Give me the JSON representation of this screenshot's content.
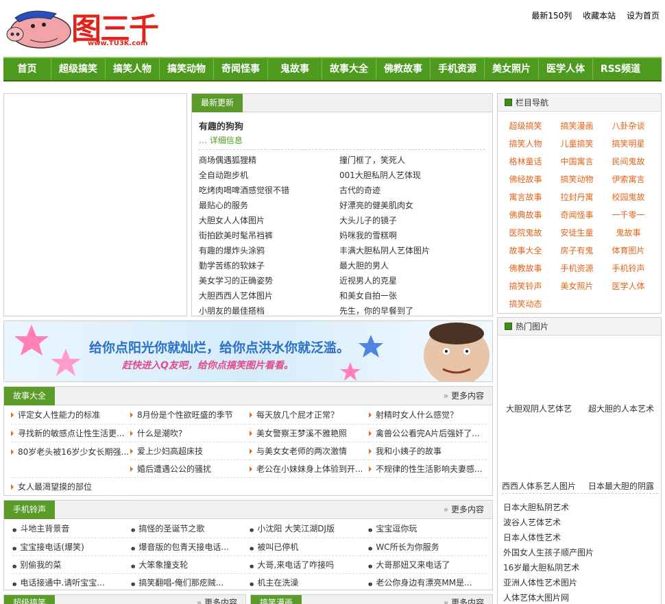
{
  "header": {
    "logo_text": "图三千",
    "logo_sub": "www.TU3K.com",
    "top_links": [
      "最新150列",
      "收藏本站",
      "设为首页"
    ]
  },
  "nav": [
    "首页",
    "超级搞笑",
    "搞笑人物",
    "搞笑动物",
    "奇闻怪事",
    "鬼故事",
    "故事大全",
    "佛教故事",
    "手机资源",
    "美女照片",
    "医学人体",
    "RSS频道"
  ],
  "latest": {
    "tab": "最新更新",
    "headline": "有趣的狗狗",
    "detail": "… 详细信息",
    "left": [
      "商场偶遇狐狸精",
      "全自动跑步机",
      "吃烤肉喝啤酒感觉很不错",
      "最贴心的服务",
      "大胆女人人体图片",
      "街拍欧美时髦吊裆裤",
      "有趣的爆炸头涂鸦",
      "勤学苦练的软妹子",
      "美女学习的正确姿势",
      "大胆西西人艺体图片",
      "小朋友的最佳搭档"
    ],
    "right": [
      "撞门框了，笑死人",
      "001大胆私阴人艺体现",
      "古代的奇迹",
      "好漂亮的健美肌肉女",
      "大头儿子的镜子",
      "妈咪我的雪糕啊",
      "丰满大胆私阴人艺体图片",
      "最大胆的男人",
      "近视男人的克星",
      "和美女自拍一张",
      "先生，你的早餐到了"
    ]
  },
  "banner": {
    "line1": "给你点阳光你就灿烂，给你点洪水你就泛滥。",
    "line2": "赶快进入Q友吧，给你点搞笑图片看看。"
  },
  "stories": {
    "tab": "故事大全",
    "more": "更多内容",
    "rows": [
      [
        "评定女人性能力的标准",
        "8月份是个性欲旺盛的季节",
        "每天放几个屁才正常？",
        "射精时女人什么感觉？"
      ],
      [
        "寻找新的敏感点让性生活更...",
        "什么是潮吹?",
        "美女警察王梦溪不雅艳照",
        "禽兽公公看完A片后强奸了..."
      ],
      [
        "80岁老头被16岁少女长期强...",
        "爱上少妇高超床技",
        "与美女女老师的两次激情",
        "我和小姨子的故事"
      ],
      [
        "",
        "婚后遭遇公公的骚扰",
        "老公在小妹妹身上体验到开...",
        "不规律的性生活影响夫妻感..."
      ],
      [
        "女人最渴望摸的部位",
        "",
        "",
        ""
      ]
    ]
  },
  "ringtones": {
    "tab": "手机铃声",
    "more": "更多内容",
    "rows": [
      [
        "斗地主背景音",
        "搞怪的圣诞节之歌",
        "小沈阳 大笑江湖DJ版",
        "宝宝逗你玩"
      ],
      [
        "宝宝接电话(爆笑)",
        "爆音版的包青天接电话...",
        "被叫已停机",
        "WC所长为你服务"
      ],
      [
        "别偷我的菜",
        "大笨象撞支轮",
        "大哥,来电话了咋接吗",
        "大哥那妞又来电话了"
      ],
      [
        "电话接通中.请听宝宝...",
        "搞笑翻唱-俺们那疙贼...",
        "机主在洗澡",
        "老公你身边有漂亮MM是..."
      ]
    ]
  },
  "bottom_tabs": [
    {
      "tab": "超级搞笑",
      "more": "更多内容"
    },
    {
      "tab": "搞笑漫画",
      "more": "更多内容"
    }
  ],
  "categories": {
    "title": "栏目导航",
    "items": [
      "超级搞笑",
      "搞笑漫画",
      "八卦杂谈",
      "搞笑人物",
      "儿童搞笑",
      "搞笑明星",
      "格林童话",
      "中国寓言",
      "民间鬼故",
      "佛经故事",
      "搞笑动物",
      "伊索寓言",
      "寓言故事",
      "拉封丹寓",
      "校园鬼故",
      "佛典故事",
      "奇闻怪事",
      "一千零一",
      "医院鬼故",
      "安徒生童",
      "鬼故事",
      "故事大全",
      "房子有鬼",
      "体育图片",
      "佛教故事",
      "手机资源",
      "手机铃声",
      "搞笑铃声",
      "美女照片",
      "医学人体",
      "搞笑动态"
    ]
  },
  "hot": {
    "title": "热门图片",
    "captions": [
      "大胆观阴人艺体艺",
      "超大胆的人本艺术",
      "西西人体系艺人图片",
      "日本最大胆的阴露"
    ],
    "list": [
      "日本大胆私阴艺术",
      "波谷人艺体艺术",
      "日本人体性艺术",
      "外国女人生孩子顺产图片",
      "16岁最大胆私阴艺术",
      "亚洲人体性艺术图片",
      "人体艺体大图片网"
    ]
  },
  "colors": {
    "nav": "#4d9a1f",
    "tab": "#5a9b2a",
    "cat_link": "#e2641a",
    "logo": "#e2231a"
  }
}
